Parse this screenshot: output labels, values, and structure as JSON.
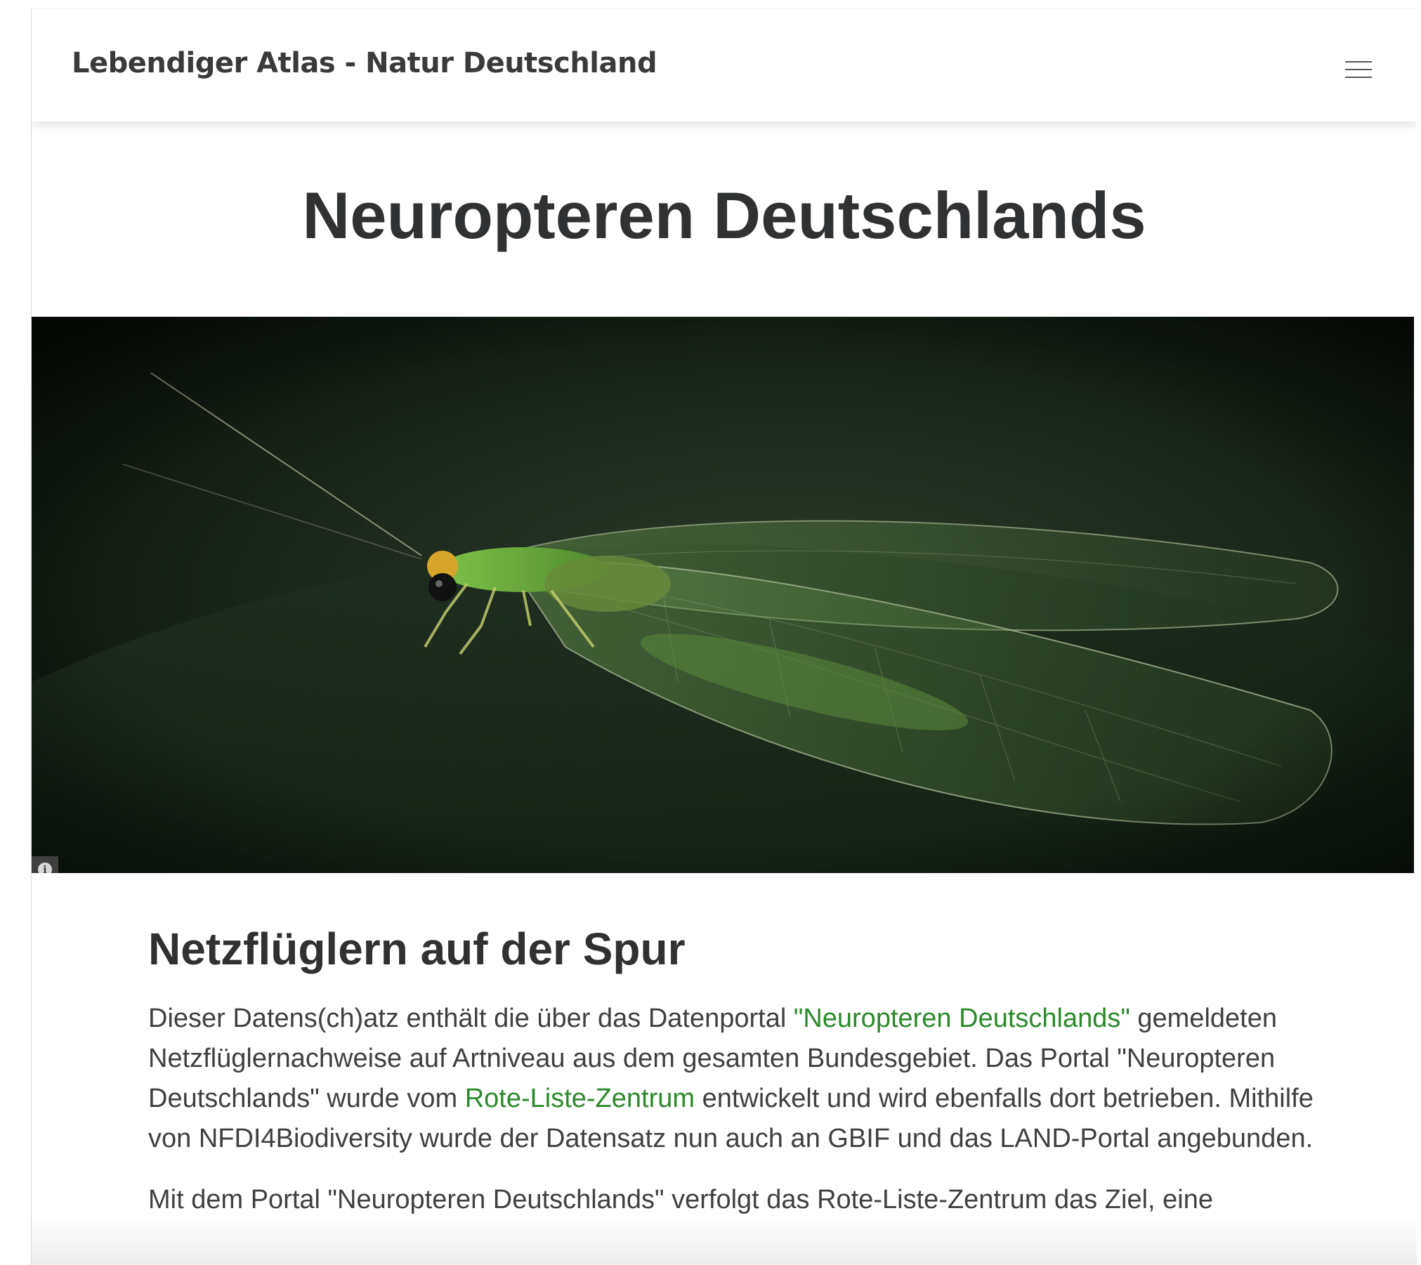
{
  "navbar": {
    "brand": "Lebendiger Atlas - Natur Deutschland",
    "menu_icon": "hamburger-menu-icon"
  },
  "page": {
    "title": "Neuropteren Deutschlands"
  },
  "hero": {
    "image_subject": "green lacewing",
    "info_icon": "info-icon",
    "info_glyph": "i"
  },
  "section": {
    "heading": "Netzflüglern auf der Spur",
    "p1_part1": "Dieser Datens(ch)atz enthält die über das Datenportal ",
    "p1_link1": "\"Neuropteren Deutschlands\"",
    "p1_part2": " gemeldeten Netzflüglernachweise auf Artniveau aus dem gesamten Bundesgebiet. Das Portal \"Neuropteren Deutschlands\" wurde vom ",
    "p1_link2": "Rote-Liste-Zentrum",
    "p1_part3": " entwickelt und wird ebenfalls dort betrieben. Mithilfe von NFDI4Biodiversity wurde der Datensatz nun auch an GBIF und das LAND-Portal angebunden.",
    "p2_start": "Mit dem Portal \"Neuropteren Deutschlands\" verfolgt das Rote-Liste-Zentrum das Ziel, eine"
  },
  "colors": {
    "link": "#2b8a2b",
    "heading": "#2f3133",
    "text": "#404040",
    "brand": "#3a3a3a"
  }
}
